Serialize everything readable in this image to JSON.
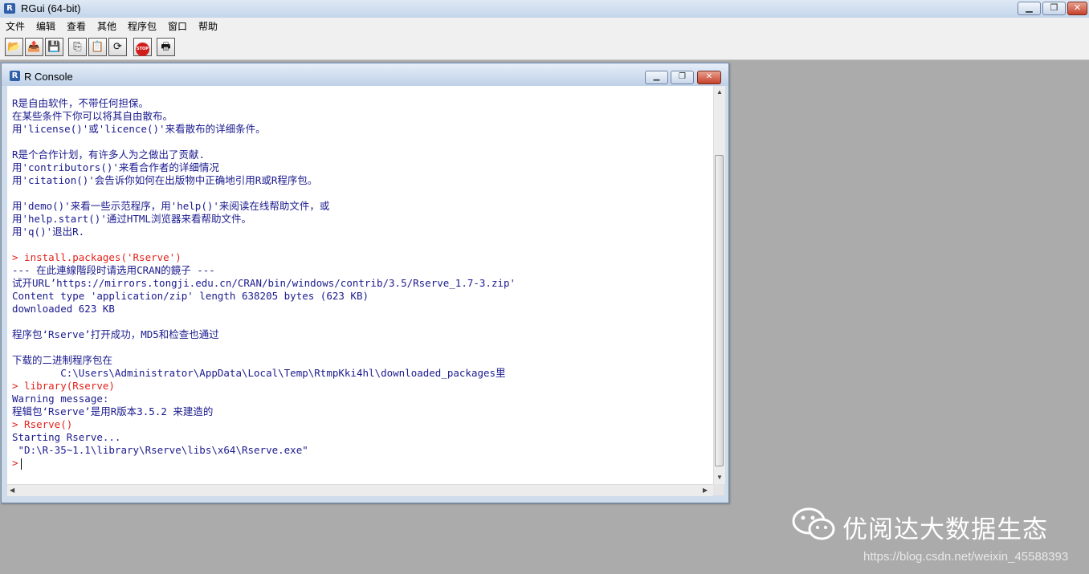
{
  "app": {
    "title": "RGui (64-bit)",
    "icon": "r-logo-icon"
  },
  "window_controls": {
    "minimize": "▁",
    "restore": "❐",
    "close": "✕"
  },
  "menu": [
    "文件",
    "编辑",
    "查看",
    "其他",
    "程序包",
    "窗口",
    "帮助"
  ],
  "toolbar": [
    {
      "name": "open-script-icon",
      "glyph": "📂"
    },
    {
      "name": "load-workspace-icon",
      "glyph": "📤"
    },
    {
      "name": "save-icon",
      "glyph": "💾"
    },
    {
      "name": "copy-icon",
      "glyph": "⎘"
    },
    {
      "name": "paste-icon",
      "glyph": "📋"
    },
    {
      "name": "refresh-icon",
      "glyph": "⟳"
    },
    {
      "name": "stop-icon",
      "glyph": "STOP"
    },
    {
      "name": "print-icon",
      "glyph": "🖶"
    }
  ],
  "console": {
    "title": "R Console",
    "lines": [
      {
        "text": "R是自由软件，不带任何担保。",
        "type": "out"
      },
      {
        "text": "在某些条件下你可以将其自由散布。",
        "type": "out"
      },
      {
        "text": "用'license()'或'licence()'来看散布的详细条件。",
        "type": "out"
      },
      {
        "text": "",
        "type": "out"
      },
      {
        "text": "R是个合作计划，有许多人为之做出了贡献.",
        "type": "out"
      },
      {
        "text": "用'contributors()'来看合作者的详细情况",
        "type": "out"
      },
      {
        "text": "用'citation()'会告诉你如何在出版物中正确地引用R或R程序包。",
        "type": "out"
      },
      {
        "text": "",
        "type": "out"
      },
      {
        "text": "用'demo()'来看一些示范程序，用'help()'来阅读在线帮助文件，或",
        "type": "out"
      },
      {
        "text": "用'help.start()'通过HTML浏览器来看帮助文件。",
        "type": "out"
      },
      {
        "text": "用'q()'退出R.",
        "type": "out"
      },
      {
        "text": "",
        "type": "out"
      },
      {
        "text": "> install.packages('Rserve')",
        "type": "cmd"
      },
      {
        "text": "--- 在此連線階段时请选用CRAN的鏡子 ---",
        "type": "out"
      },
      {
        "text": "试开URL’https://mirrors.tongji.edu.cn/CRAN/bin/windows/contrib/3.5/Rserve_1.7-3.zip'",
        "type": "out"
      },
      {
        "text": "Content type 'application/zip' length 638205 bytes (623 KB)",
        "type": "out"
      },
      {
        "text": "downloaded 623 KB",
        "type": "out"
      },
      {
        "text": "",
        "type": "out"
      },
      {
        "text": "程序包‘Rserve’打开成功，MD5和检查也通过",
        "type": "out"
      },
      {
        "text": "",
        "type": "out"
      },
      {
        "text": "下载的二进制程序包在",
        "type": "out"
      },
      {
        "text": "        C:\\Users\\Administrator\\AppData\\Local\\Temp\\RtmpKki4hl\\downloaded_packages里",
        "type": "out"
      },
      {
        "text": "> library(Rserve)",
        "type": "cmd"
      },
      {
        "text": "Warning message:",
        "type": "out"
      },
      {
        "text": "程辑包‘Rserve’是用R版本3.5.2 来建造的",
        "type": "out"
      },
      {
        "text": "> Rserve()",
        "type": "cmd"
      },
      {
        "text": "Starting Rserve...",
        "type": "out"
      },
      {
        "text": " \"D:\\R-35~1.1\\library\\Rserve\\libs\\x64\\Rserve.exe\"",
        "type": "out"
      }
    ],
    "prompt": ">"
  },
  "watermark": {
    "brand": "优阅达大数据生态",
    "url": "https://blog.csdn.net/weixin_45588393",
    "icon": "wechat-icon"
  },
  "colors": {
    "output_text": "#1a1a8e",
    "command_text": "#e3221b",
    "desktop": "#ababab"
  }
}
